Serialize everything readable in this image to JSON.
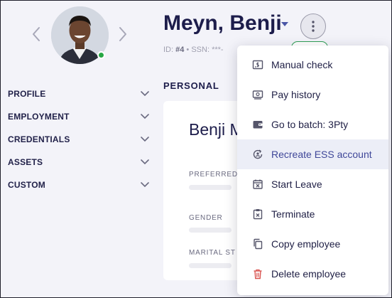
{
  "employee": {
    "name": "Meyn, Benji",
    "id_label": "ID:",
    "id_value": "#4",
    "ssn_label": "SSN:",
    "ssn_value": "***-",
    "card_name": "Benji M"
  },
  "sidebar": {
    "items": [
      {
        "label": "PROFILE"
      },
      {
        "label": "EMPLOYMENT"
      },
      {
        "label": "CREDENTIALS"
      },
      {
        "label": "ASSETS"
      },
      {
        "label": "CUSTOM"
      }
    ]
  },
  "main": {
    "section_title": "PERSONAL",
    "fields": [
      {
        "label": "PREFERRED"
      },
      {
        "label": "GENDER"
      },
      {
        "label": "MARITAL ST"
      }
    ]
  },
  "actions_menu": {
    "items": [
      {
        "label": "Manual check",
        "icon": "check-document-icon"
      },
      {
        "label": "Pay history",
        "icon": "pay-history-icon"
      },
      {
        "label": "Go to batch: 3Pty",
        "icon": "wallet-icon"
      },
      {
        "label": "Recreate ESS account",
        "icon": "recreate-account-icon"
      },
      {
        "label": "Start Leave",
        "icon": "calendar-x-icon"
      },
      {
        "label": "Terminate",
        "icon": "clipboard-terminate-icon"
      },
      {
        "label": "Copy employee",
        "icon": "copy-icon"
      },
      {
        "label": "Delete employee",
        "icon": "trash-icon"
      }
    ]
  },
  "colors": {
    "accent": "#4a56a6",
    "name": "#1d1d4b",
    "online": "#27a745",
    "danger": "#d9534f",
    "background": "#f3f3f9"
  }
}
